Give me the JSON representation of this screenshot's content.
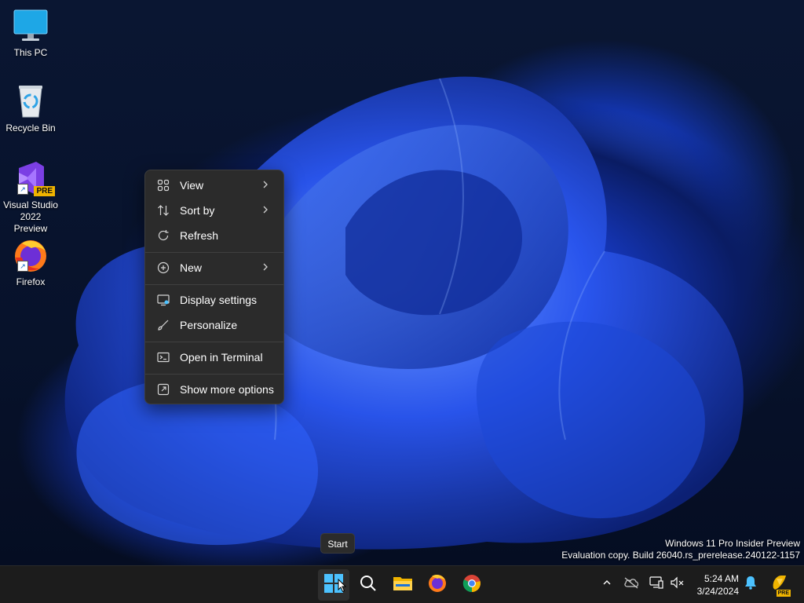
{
  "desktop": {
    "icons": [
      {
        "label": "This PC",
        "icon": "monitor-icon"
      },
      {
        "label": "Recycle Bin",
        "icon": "recycle-bin-icon"
      },
      {
        "label": "Visual Studio 2022 Preview",
        "icon": "visual-studio-icon",
        "badge": "PRE"
      },
      {
        "label": "Firefox",
        "icon": "firefox-icon"
      }
    ]
  },
  "context_menu": {
    "items": [
      {
        "label": "View",
        "icon": "grid-icon",
        "submenu": true
      },
      {
        "label": "Sort by",
        "icon": "sort-icon",
        "submenu": true
      },
      {
        "label": "Refresh",
        "icon": "refresh-icon",
        "submenu": false
      },
      {
        "label": "New",
        "icon": "plus-circle-icon",
        "submenu": true
      },
      {
        "label": "Display settings",
        "icon": "display-icon",
        "submenu": false
      },
      {
        "label": "Personalize",
        "icon": "brush-icon",
        "submenu": false
      },
      {
        "label": "Open in Terminal",
        "icon": "terminal-icon",
        "submenu": false
      },
      {
        "label": "Show more options",
        "icon": "expand-icon",
        "submenu": false
      }
    ]
  },
  "tooltip": {
    "text": "Start"
  },
  "watermark": {
    "line1": "Windows 11 Pro Insider Preview",
    "line2": "Evaluation copy. Build 26040.rs_prerelease.240122-1157"
  },
  "taskbar": {
    "apps": [
      "start-icon",
      "search-icon",
      "file-explorer-icon",
      "firefox-icon",
      "chrome-icon"
    ],
    "tray": [
      "chevron-up-icon",
      "onedrive-icon",
      "network-icon",
      "volume-muted-icon"
    ],
    "time": "5:24 AM",
    "date": "3/24/2024",
    "copilot_badge": "PRE"
  },
  "colors": {
    "accent": "#4cc2ff",
    "taskbar": "#1c1c1c",
    "menu": "#2b2b2b"
  }
}
